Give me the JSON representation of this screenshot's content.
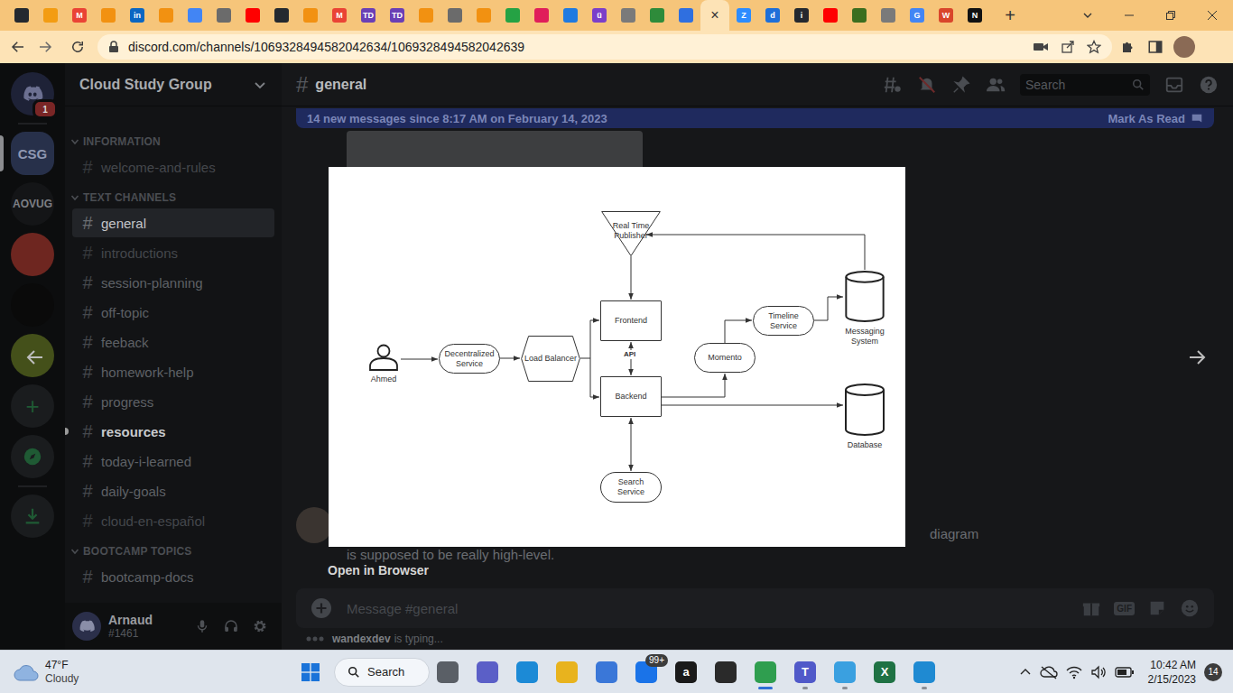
{
  "browser": {
    "tabs": [
      {
        "selected": false,
        "color": "#24292f"
      },
      {
        "selected": false,
        "color": "#f39c12"
      },
      {
        "selected": false,
        "color": "#ea4335",
        "glyph": "M"
      },
      {
        "selected": false,
        "color": "#f29111"
      },
      {
        "selected": false,
        "color": "#0a66c2",
        "glyph": "in"
      },
      {
        "selected": false,
        "color": "#f29111"
      },
      {
        "selected": false,
        "color": "#4285f4"
      },
      {
        "selected": false,
        "color": "#6b6b6b"
      },
      {
        "selected": false,
        "color": "#ff0000"
      },
      {
        "selected": false,
        "color": "#24292f"
      },
      {
        "selected": false,
        "color": "#f29111"
      },
      {
        "selected": false,
        "color": "#ea4335",
        "glyph": "M"
      },
      {
        "selected": false,
        "color": "#6a3fb5",
        "glyph": "TD"
      },
      {
        "selected": false,
        "color": "#6a3fb5",
        "glyph": "TD"
      },
      {
        "selected": false,
        "color": "#f29111"
      },
      {
        "selected": false,
        "color": "#6b6b6b"
      },
      {
        "selected": false,
        "color": "#f29111"
      },
      {
        "selected": false,
        "color": "#25a244"
      },
      {
        "selected": false,
        "color": "#e01e5a"
      },
      {
        "selected": false,
        "color": "#1f7ae0"
      },
      {
        "selected": false,
        "color": "#7b3fc9",
        "glyph": "ü"
      },
      {
        "selected": false,
        "color": "#7a7a7a"
      },
      {
        "selected": false,
        "color": "#2e8b3a"
      },
      {
        "selected": false,
        "color": "#2f6fe0"
      },
      {
        "selected": true
      },
      {
        "selected": false,
        "color": "#2d8cff",
        "glyph": "Z"
      },
      {
        "selected": false,
        "color": "#1e6fd9",
        "glyph": "d"
      },
      {
        "selected": false,
        "color": "#24292f",
        "glyph": "i"
      },
      {
        "selected": false,
        "color": "#ff0000"
      },
      {
        "selected": false,
        "color": "#3b6e1f"
      },
      {
        "selected": false,
        "color": "#7a7a7a"
      },
      {
        "selected": false,
        "color": "#4285f4",
        "glyph": "G"
      },
      {
        "selected": false,
        "color": "#d9452b",
        "glyph": "W"
      },
      {
        "selected": false,
        "color": "#111111",
        "glyph": "N"
      }
    ],
    "close_glyph": "×",
    "new_tab": "+",
    "url": "discord.com/channels/1069328494582042634/1069328494582042639"
  },
  "discord": {
    "servers": [
      {
        "kind": "home",
        "selected": false,
        "color": "#1e2237",
        "badge": "1"
      },
      {
        "kind": "text",
        "label": "CSG",
        "selected": true,
        "color": "#27304a"
      },
      {
        "kind": "text",
        "label": "AOVUG",
        "selected": false,
        "color": "#141517"
      },
      {
        "kind": "image",
        "selected": false,
        "color": "#6e2620"
      },
      {
        "kind": "image",
        "selected": false,
        "color": "#0a0a0a"
      },
      {
        "kind": "image",
        "selected": false,
        "color": "#44501a"
      },
      {
        "kind": "add",
        "label": "+",
        "selected": false,
        "color": "#1a1c1e"
      },
      {
        "kind": "explore",
        "selected": false,
        "color": "#1a1c1e"
      },
      {
        "kind": "download",
        "selected": false,
        "color": "#1a1c1e"
      }
    ],
    "channel_glyph": "#",
    "sidebar": {
      "server_name": "Cloud Study Group",
      "sections": [
        {
          "title": "INFORMATION",
          "expanded": true,
          "channels": [
            {
              "name": "welcome-and-rules",
              "selected": false,
              "unread": false,
              "muted": true
            }
          ]
        },
        {
          "title": "TEXT CHANNELS",
          "expanded": true,
          "channels": [
            {
              "name": "general",
              "selected": true,
              "unread": false,
              "muted": false
            },
            {
              "name": "introductions",
              "selected": false,
              "unread": false,
              "muted": true
            },
            {
              "name": "session-planning",
              "selected": false,
              "unread": false,
              "muted": false
            },
            {
              "name": "off-topic",
              "selected": false,
              "unread": false,
              "muted": false
            },
            {
              "name": "feeback",
              "selected": false,
              "unread": false,
              "muted": false
            },
            {
              "name": "homework-help",
              "selected": false,
              "unread": false,
              "muted": false
            },
            {
              "name": "progress",
              "selected": false,
              "unread": false,
              "muted": false
            },
            {
              "name": "resources",
              "selected": false,
              "unread": true,
              "muted": false
            },
            {
              "name": "today-i-learned",
              "selected": false,
              "unread": false,
              "muted": false
            },
            {
              "name": "daily-goals",
              "selected": false,
              "unread": false,
              "muted": false
            },
            {
              "name": "cloud-en-español",
              "selected": false,
              "unread": false,
              "muted": true
            }
          ]
        },
        {
          "title": "BOOTCAMP TOPICS",
          "expanded": true,
          "channels": [
            {
              "name": "bootcamp-docs",
              "selected": false,
              "unread": false,
              "muted": false
            }
          ]
        }
      ]
    },
    "user": {
      "name": "Arnaud",
      "tag": "#1461"
    },
    "header": {
      "channel": "general",
      "search_placeholder": "Search"
    },
    "banner": {
      "text": "14 new messages since 8:17 AM on February 14, 2023",
      "action": "Mark As Read"
    },
    "message": {
      "line1": "diagram",
      "line2": "is supposed to be really high-level."
    },
    "composer": {
      "placeholder": "Message #general",
      "gif": "GIF"
    },
    "typing": {
      "user": "wandexdev",
      "text": "is typing..."
    }
  },
  "lightbox": {
    "diagram": {
      "nodes": [
        {
          "label": "Ahmed",
          "kind": "person"
        },
        {
          "label": "Decentralized Service",
          "kind": "pill"
        },
        {
          "label": "Load Balancer",
          "kind": "hexagon"
        },
        {
          "label": "Real Time Publisher",
          "kind": "triangle"
        },
        {
          "label": "Frontend",
          "kind": "rect"
        },
        {
          "label": "Backend",
          "kind": "rect"
        },
        {
          "label": "Search Service",
          "kind": "pill"
        },
        {
          "label": "Momento",
          "kind": "pill"
        },
        {
          "label": "Timeline Service",
          "kind": "pill"
        },
        {
          "label": "Messaging System",
          "kind": "cylinder"
        },
        {
          "label": "Database",
          "kind": "cylinder"
        }
      ],
      "edge_labels": [
        "API"
      ]
    },
    "open_link": "Open in Browser"
  },
  "taskbar": {
    "weather": {
      "temp": "47°F",
      "condition": "Cloudy"
    },
    "search": "Search",
    "apps": [
      {
        "selected": false,
        "running": false,
        "color": "#5a5f66"
      },
      {
        "selected": false,
        "running": false,
        "color": "#5b5fc7"
      },
      {
        "selected": false,
        "running": false,
        "color": "#1c8ad6"
      },
      {
        "selected": false,
        "running": false,
        "color": "#e8b31e"
      },
      {
        "selected": false,
        "running": false,
        "color": "#3a77d8"
      },
      {
        "selected": false,
        "running": false,
        "color": "#1a73e8",
        "badge": "99+"
      },
      {
        "selected": false,
        "running": false,
        "color": "#1a1a1a",
        "glyph": "a"
      },
      {
        "selected": false,
        "running": false,
        "color": "#2a2a2a"
      },
      {
        "selected": true,
        "running": true,
        "color": "#2f9e4f"
      },
      {
        "selected": false,
        "running": true,
        "color": "#5059c9",
        "glyph": "T"
      },
      {
        "selected": false,
        "running": true,
        "color": "#3aa0e0"
      },
      {
        "selected": false,
        "running": false,
        "color": "#1f7244",
        "glyph": "X"
      },
      {
        "selected": false,
        "running": true,
        "color": "#1f8ad2"
      }
    ],
    "clock": {
      "time": "10:42 AM",
      "date": "2/15/2023"
    },
    "notifications": "14"
  }
}
